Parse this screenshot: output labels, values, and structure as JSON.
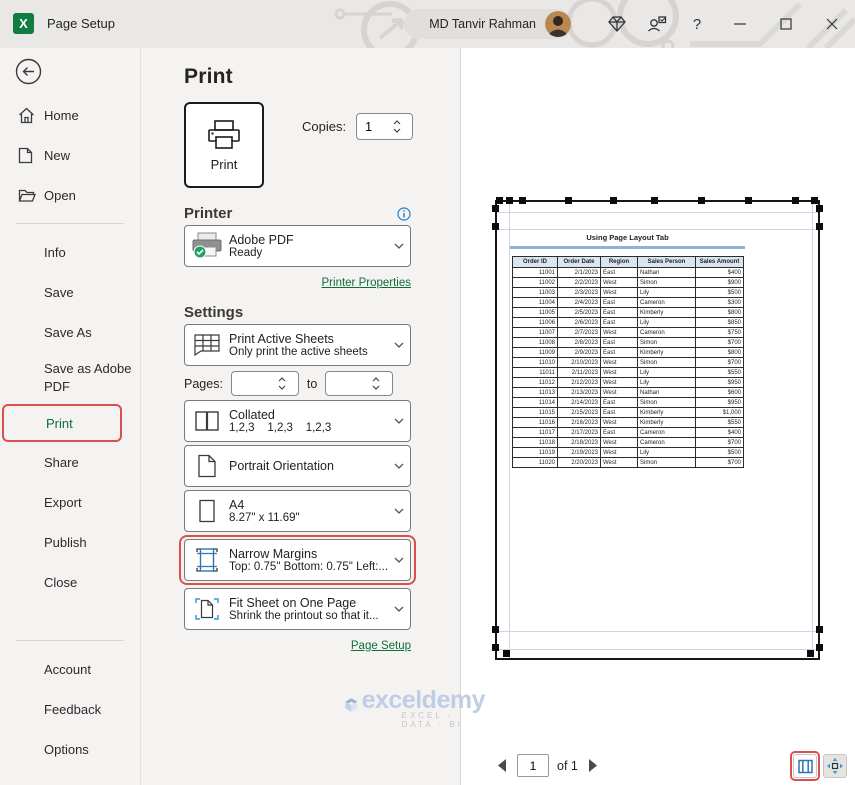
{
  "titlebar": {
    "title": "Page Setup",
    "user_name": "MD Tanvir Rahman",
    "help_label": "?"
  },
  "sidebar": {
    "primary_items": [
      {
        "label": "Home",
        "icon": "home-icon"
      },
      {
        "label": "New",
        "icon": "new-document-icon"
      },
      {
        "label": "Open",
        "icon": "open-folder-icon"
      }
    ],
    "secondary_items": [
      "Info",
      "Save",
      "Save As",
      "Save as Adobe PDF",
      "Print",
      "Share",
      "Export",
      "Publish",
      "Close"
    ],
    "active_item": "Print",
    "footer_items": [
      "Account",
      "Feedback",
      "Options"
    ]
  },
  "main": {
    "page_title": "Print",
    "print_button_label": "Print",
    "copies": {
      "label": "Copies:",
      "value": "1"
    },
    "printer_section": {
      "heading": "Printer",
      "printer_name": "Adobe PDF",
      "printer_status": "Ready",
      "properties_link": "Printer Properties"
    },
    "settings_section": {
      "heading": "Settings",
      "sheets_dropdown": {
        "title": "Print Active Sheets",
        "subtitle": "Only print the active sheets"
      },
      "pages": {
        "label": "Pages:",
        "from_value": "",
        "to_label": "to",
        "to_value": ""
      },
      "collation_dropdown": {
        "title": "Collated",
        "subtitle": "1,2,3    1,2,3    1,2,3"
      },
      "orientation_dropdown": {
        "title": "Portrait Orientation"
      },
      "paper_dropdown": {
        "title": "A4",
        "subtitle": "8.27\" x 11.69\""
      },
      "margins_dropdown": {
        "title": "Narrow Margins",
        "subtitle": "Top: 0.75\" Bottom: 0.75\" Left:..."
      },
      "scaling_dropdown": {
        "title": "Fit Sheet on One Page",
        "subtitle": "Shrink the printout so that it..."
      },
      "page_setup_link": "Page Setup"
    }
  },
  "preview": {
    "sheet": {
      "title": "Using Page Layout Tab",
      "table": {
        "headers": [
          "Order ID",
          "Order Date",
          "Region",
          "Sales Person",
          "Sales Amount"
        ],
        "rows": [
          [
            "11001",
            "2/1/2023",
            "East",
            "Nathan",
            "$400"
          ],
          [
            "11002",
            "2/2/2023",
            "West",
            "Simon",
            "$900"
          ],
          [
            "11003",
            "2/3/2023",
            "West",
            "Lily",
            "$500"
          ],
          [
            "11004",
            "2/4/2023",
            "East",
            "Cameron",
            "$300"
          ],
          [
            "11005",
            "2/5/2023",
            "East",
            "Kimberly",
            "$800"
          ],
          [
            "11006",
            "2/6/2023",
            "East",
            "Lily",
            "$850"
          ],
          [
            "11007",
            "2/7/2023",
            "West",
            "Cameron",
            "$750"
          ],
          [
            "11008",
            "2/8/2023",
            "East",
            "Simon",
            "$700"
          ],
          [
            "11009",
            "2/9/2023",
            "East",
            "Kimberly",
            "$800"
          ],
          [
            "11010",
            "2/10/2023",
            "West",
            "Simon",
            "$700"
          ],
          [
            "11011",
            "2/11/2023",
            "West",
            "Lily",
            "$550"
          ],
          [
            "11012",
            "2/12/2023",
            "West",
            "Lily",
            "$950"
          ],
          [
            "11013",
            "2/13/2023",
            "West",
            "Nathan",
            "$600"
          ],
          [
            "11014",
            "2/14/2023",
            "East",
            "Simon",
            "$950"
          ],
          [
            "11015",
            "2/15/2023",
            "East",
            "Kimberly",
            "$1,000"
          ],
          [
            "11016",
            "2/16/2023",
            "West",
            "Kimberly",
            "$550"
          ],
          [
            "11017",
            "2/17/2023",
            "East",
            "Cameron",
            "$400"
          ],
          [
            "11018",
            "2/18/2023",
            "West",
            "Cameron",
            "$700"
          ],
          [
            "11019",
            "2/19/2023",
            "West",
            "Lily",
            "$500"
          ],
          [
            "11020",
            "2/20/2023",
            "West",
            "Simon",
            "$700"
          ]
        ]
      }
    },
    "pager": {
      "page_value": "1",
      "of_label": "of 1"
    }
  },
  "watermark": {
    "brand": "exceldemy",
    "tagline": "EXCEL - DATA - BI"
  },
  "colors": {
    "excel_green": "#107c41",
    "link_green": "#0e6e39",
    "annotation_red": "#dd4f4f",
    "accent_blue": "#2e75b6",
    "table_header_fill": "#dbe5f1",
    "title_underline_blue": "#8fb0d8"
  }
}
